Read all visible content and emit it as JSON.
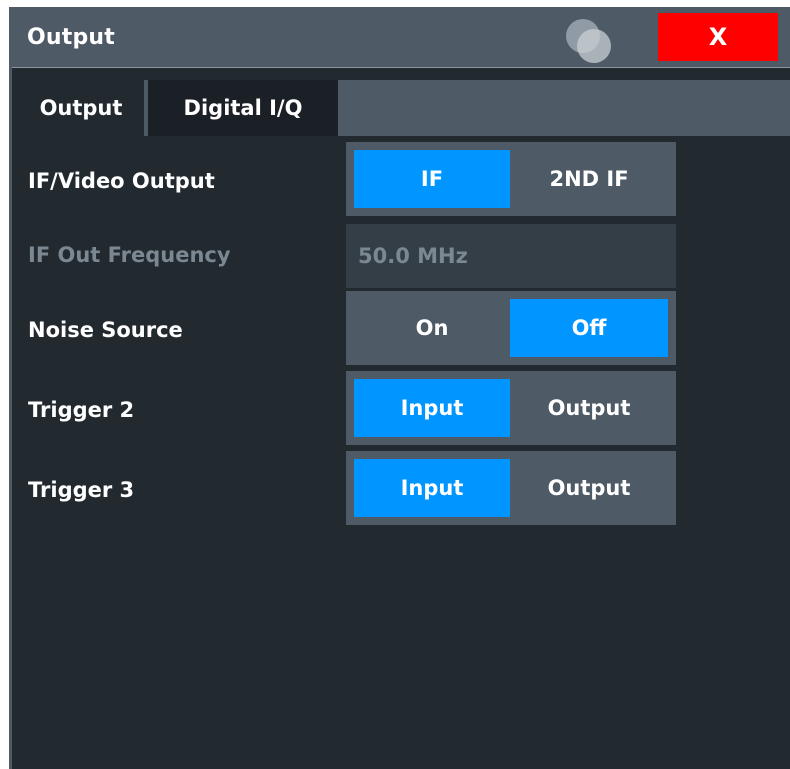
{
  "window": {
    "title": "Output",
    "close_label": "X"
  },
  "tabs": [
    {
      "label": "Output",
      "active": true
    },
    {
      "label": "Digital I/Q",
      "active": false
    }
  ],
  "rows": {
    "if_video_output": {
      "label": "IF/Video Output",
      "options": [
        "IF",
        "2ND IF"
      ],
      "selected": "IF"
    },
    "if_out_frequency": {
      "label": "IF Out Frequency",
      "value": "50.0 MHz",
      "enabled": false
    },
    "noise_source": {
      "label": "Noise Source",
      "options": [
        "On",
        "Off"
      ],
      "selected": "Off"
    },
    "trigger_2": {
      "label": "Trigger 2",
      "options": [
        "Input",
        "Output"
      ],
      "selected": "Input"
    },
    "trigger_3": {
      "label": "Trigger 3",
      "options": [
        "Input",
        "Output"
      ],
      "selected": "Input"
    }
  },
  "colors": {
    "selected": "#0095ff",
    "close": "#ff0000",
    "panel": "#222a30",
    "chrome": "#4e5a66"
  }
}
